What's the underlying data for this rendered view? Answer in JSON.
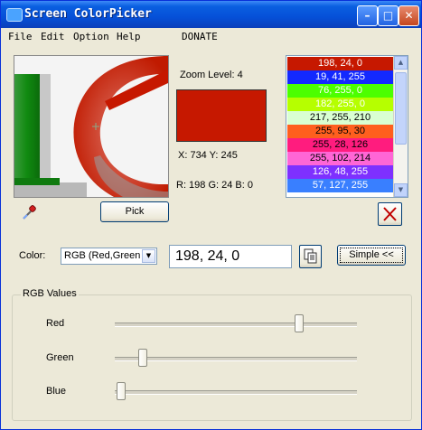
{
  "window": {
    "title": "Screen ColorPicker",
    "minimize_glyph": "–",
    "maximize_glyph": "□",
    "close_glyph": "✕"
  },
  "menu": [
    "File",
    "Edit",
    "Option",
    "Help",
    "DONATE"
  ],
  "info": {
    "zoom_label": "Zoom Level: 4",
    "coords": "X: 734 Y: 245",
    "rgb_readout": "R: 198 G: 24 B: 0",
    "preview_color": "#c61800"
  },
  "color_list": [
    {
      "label": "198, 24, 0",
      "bg": "#c61800",
      "fg": "#ffffff"
    },
    {
      "label": "19, 41, 255",
      "bg": "#1329ff",
      "fg": "#ffffff"
    },
    {
      "label": "76, 255, 0",
      "bg": "#4cff00",
      "fg": "#ffffff"
    },
    {
      "label": "182, 255, 0",
      "bg": "#b6ff00",
      "fg": "#ffffff"
    },
    {
      "label": "217, 255, 210",
      "bg": "#d9ffd2",
      "fg": "#000000"
    },
    {
      "label": "255, 95, 30",
      "bg": "#ff5f1e",
      "fg": "#000000"
    },
    {
      "label": "255, 28, 126",
      "bg": "#ff1c7e",
      "fg": "#000000"
    },
    {
      "label": "255, 102, 214",
      "bg": "#ff66d6",
      "fg": "#000000"
    },
    {
      "label": "126, 48, 255",
      "bg": "#7e30ff",
      "fg": "#ffffff"
    },
    {
      "label": "57, 127, 255",
      "bg": "#397fff",
      "fg": "#ffffff"
    }
  ],
  "buttons": {
    "pick": "Pick",
    "simple": "Simple <<"
  },
  "format": {
    "label": "Color:",
    "selected": "RGB (Red,Green,Blue)",
    "value": "198, 24, 0"
  },
  "sliders": {
    "group_title": "RGB Values",
    "red_label": "Red",
    "green_label": "Green",
    "blue_label": "Blue",
    "red": 198,
    "green": 24,
    "blue": 0,
    "max": 255
  }
}
